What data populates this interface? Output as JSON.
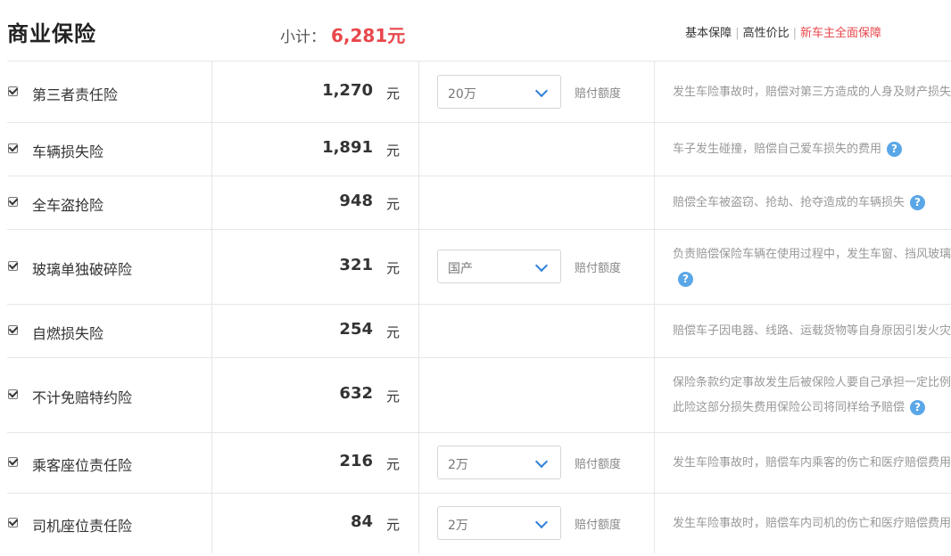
{
  "header": {
    "title": "商业保险",
    "subtotal_label": "小计：",
    "subtotal_value": "6,281元",
    "plans": [
      {
        "label": "基本保障",
        "active": false
      },
      {
        "label": "高性价比",
        "active": false
      },
      {
        "label": "新车主全面保障",
        "active": true
      }
    ]
  },
  "rows": [
    {
      "name": "第三者责任险",
      "price": "1,270",
      "unit": "元",
      "select": "20万",
      "coverage_label": "赔付额度",
      "desc": [
        "发生车险事故时，赔偿对第三方造成的人身及财产损失"
      ],
      "help": false
    },
    {
      "name": "车辆损失险",
      "price": "1,891",
      "unit": "元",
      "select": "",
      "coverage_label": "",
      "desc": [
        "车子发生碰撞，赔偿自己爱车损失的费用"
      ],
      "help": true
    },
    {
      "name": "全车盗抢险",
      "price": "948",
      "unit": "元",
      "select": "",
      "coverage_label": "",
      "desc": [
        "赔偿全车被盗窃、抢劫、抢夺造成的车辆损失"
      ],
      "help": true
    },
    {
      "name": "玻璃单独破碎险",
      "price": "321",
      "unit": "元",
      "select": "国产",
      "coverage_label": "赔付额度",
      "desc": [
        "负责赔偿保险车辆在使用过程中，发生车窗、挡风玻璃",
        ""
      ],
      "help": true
    },
    {
      "name": "自燃损失险",
      "price": "254",
      "unit": "元",
      "select": "",
      "coverage_label": "",
      "desc": [
        "赔偿车子因电器、线路、运载货物等自身原因引发火灾"
      ],
      "help": false
    },
    {
      "name": "不计免赔特约险",
      "price": "632",
      "unit": "元",
      "select": "",
      "coverage_label": "",
      "desc": [
        "保险条款约定事故发生后被保险人要自己承担一定比例",
        "此险这部分损失费用保险公司将同样给予赔偿"
      ],
      "help": true
    },
    {
      "name": "乘客座位责任险",
      "price": "216",
      "unit": "元",
      "select": "2万",
      "coverage_label": "赔付额度",
      "desc": [
        "发生车险事故时，赔偿车内乘客的伤亡和医疗赔偿费用"
      ],
      "help": false
    },
    {
      "name": "司机座位责任险",
      "price": "84",
      "unit": "元",
      "select": "2万",
      "coverage_label": "赔付额度",
      "desc": [
        "发生车险事故时，赔偿车内司机的伤亡和医疗赔偿费用"
      ],
      "help": false
    }
  ],
  "colors": {
    "accent": "#e8474c",
    "help": "#5aa7e8",
    "chevron": "#2f7fd8"
  }
}
